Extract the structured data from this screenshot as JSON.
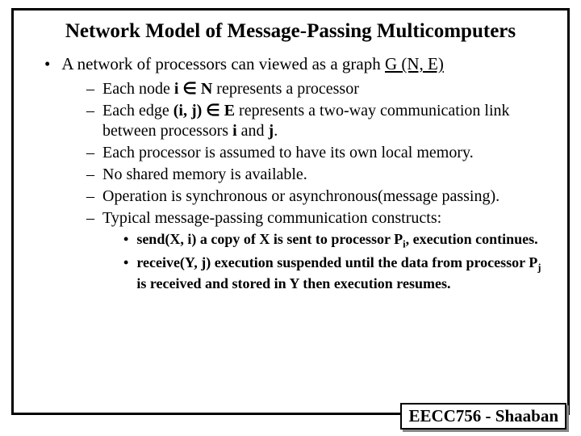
{
  "title": "Network Model of Message-Passing Multicomputers",
  "lvl1_prefix": "A network of processors can viewed as a graph ",
  "lvl1_graph": "G (N, E)",
  "items": {
    "i0a": "Each node ",
    "i0b": "i ∈ N",
    "i0c": " represents a processor",
    "i1a": "Each edge ",
    "i1b": "(i, j) ∈ E",
    "i1c": " represents a two-way communication link between processors ",
    "i1d": "i",
    "i1e": " and ",
    "i1f": "j",
    "i1g": ".",
    "i2": "Each processor is assumed to have its own local memory.",
    "i3": "No shared memory is available.",
    "i4": "Operation is synchronous or asynchronous(message passing).",
    "i5": "Typical message-passing communication constructs:"
  },
  "sub": {
    "s0a": "send(X, i)",
    "s0b": " a copy of X is sent to processor P",
    "s0c": "i",
    "s0d": ", execution continues.",
    "s1a": "receive(Y, j)",
    "s1b": " execution suspended until the data from processor P",
    "s1c": "j",
    "s1d": " is received and stored in Y then execution resumes."
  },
  "footer": "EECC756 - Shaaban"
}
